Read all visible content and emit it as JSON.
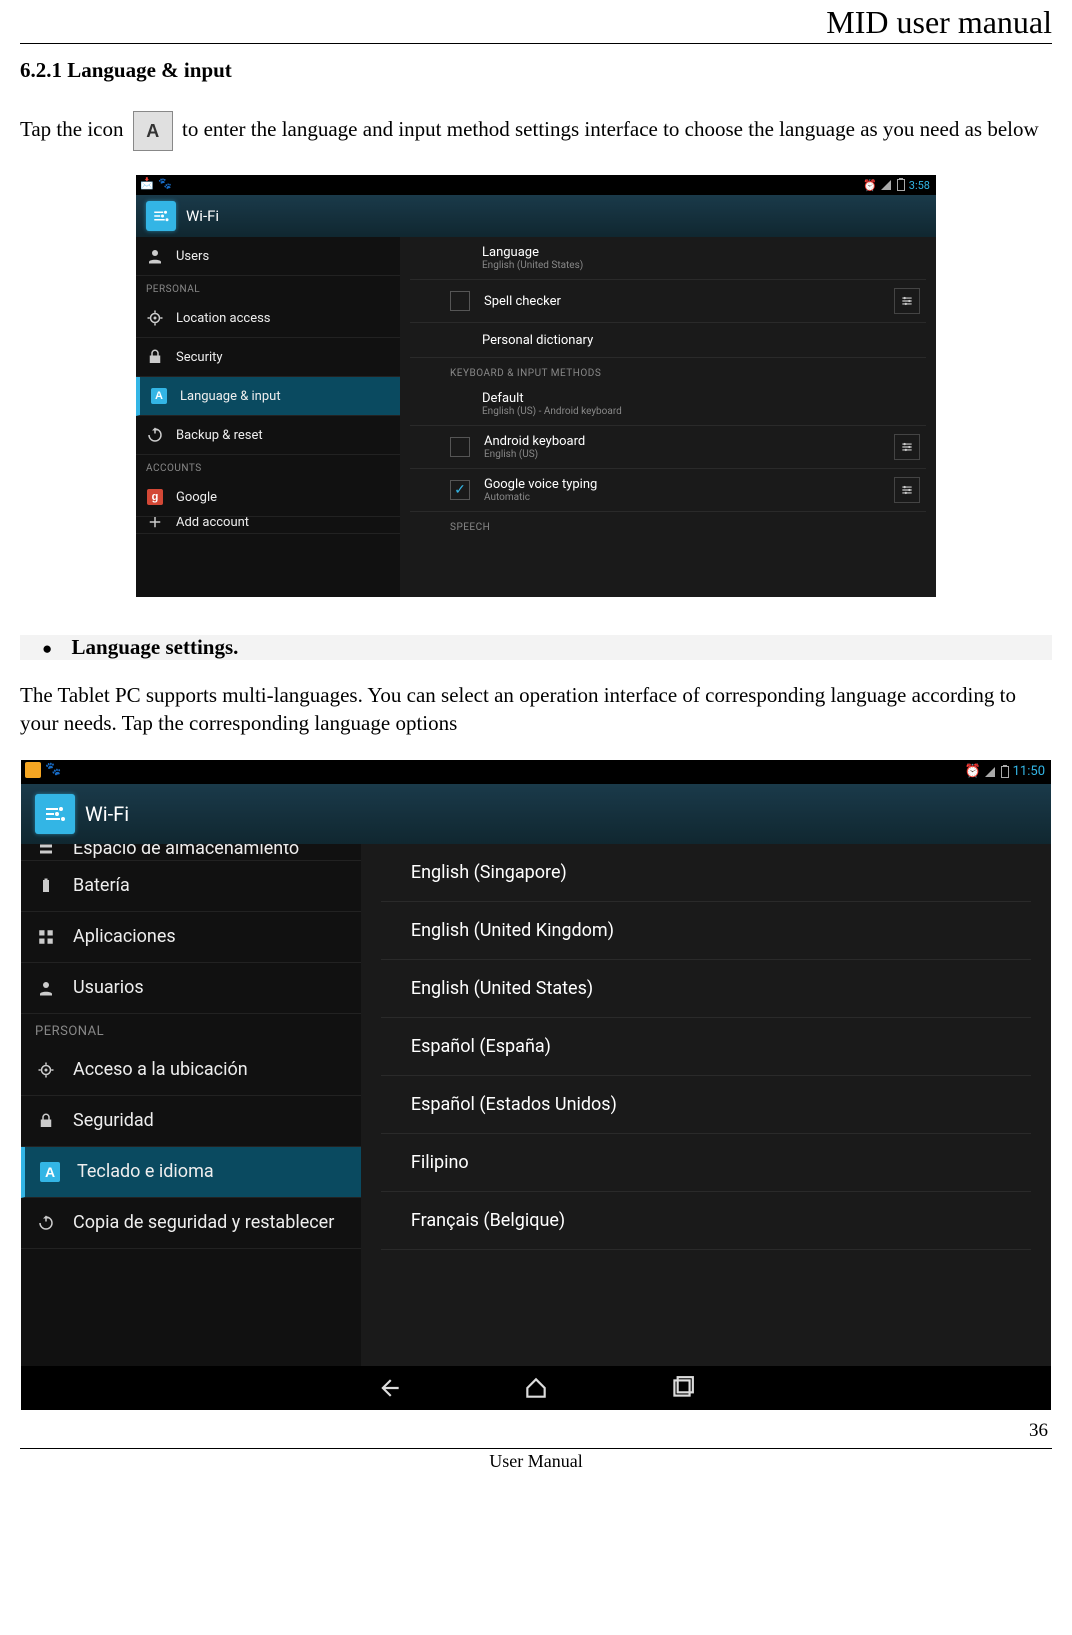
{
  "doc": {
    "header": "MID user manual",
    "section_number": "6.2.1",
    "section_title": "Language & input",
    "intro_prefix": "Tap the icon",
    "intro_icon_letter": "A",
    "intro_suffix": " to enter the language and input method settings interface to choose the language as you need as below",
    "bullet_heading": "Language settings.",
    "body": "The Tablet PC supports multi-languages. You can select an operation interface of corresponding language according to your needs. Tap the corresponding language options",
    "page_number": "36",
    "footer_label": "User Manual"
  },
  "shot1": {
    "status_time": "3:58",
    "wifi_title": "Wi-Fi",
    "sidebar": {
      "items": [
        {
          "icon": "users",
          "label": "Users"
        },
        {
          "cat": "PERSONAL"
        },
        {
          "icon": "location",
          "label": "Location access"
        },
        {
          "icon": "lock",
          "label": "Security"
        },
        {
          "icon": "lang",
          "label": "Language & input",
          "active": true
        },
        {
          "icon": "backup",
          "label": "Backup & reset"
        },
        {
          "cat": "ACCOUNTS"
        },
        {
          "icon": "google",
          "label": "Google"
        },
        {
          "icon": "add",
          "label": "Add account",
          "cut": true
        }
      ]
    },
    "main": {
      "rows": [
        {
          "title": "Language",
          "sub": "English (United States)"
        },
        {
          "title": "Spell checker",
          "check": true,
          "settings": true
        },
        {
          "title": "Personal dictionary"
        },
        {
          "cat": "KEYBOARD & INPUT METHODS"
        },
        {
          "title": "Default",
          "sub": "English (US) - Android keyboard"
        },
        {
          "title": "Android keyboard",
          "sub": "English (US)",
          "check": true,
          "settings": true
        },
        {
          "title": "Google voice typing",
          "sub": "Automatic",
          "check": true,
          "checked": true,
          "settings": true
        },
        {
          "cat": "SPEECH"
        }
      ]
    }
  },
  "shot2": {
    "status_time": "11:50",
    "wifi_title": "Wi-Fi",
    "sidebar": {
      "items": [
        {
          "icon": "storage",
          "label": "Espacio de almacenamiento",
          "cut": true
        },
        {
          "icon": "battery",
          "label": "Batería"
        },
        {
          "icon": "apps",
          "label": "Aplicaciones"
        },
        {
          "icon": "users",
          "label": "Usuarios"
        },
        {
          "cat": "PERSONAL"
        },
        {
          "icon": "location",
          "label": "Acceso a la ubicación"
        },
        {
          "icon": "lock",
          "label": "Seguridad"
        },
        {
          "icon": "lang",
          "label": "Teclado e idioma",
          "active": true
        },
        {
          "icon": "backup",
          "label": "Copia de seguridad y restablecer"
        }
      ]
    },
    "main": {
      "languages": [
        "English (Singapore)",
        "English (United Kingdom)",
        "English (United States)",
        "Español (España)",
        "Español (Estados Unidos)",
        "Filipino",
        "Français (Belgique)"
      ]
    }
  }
}
